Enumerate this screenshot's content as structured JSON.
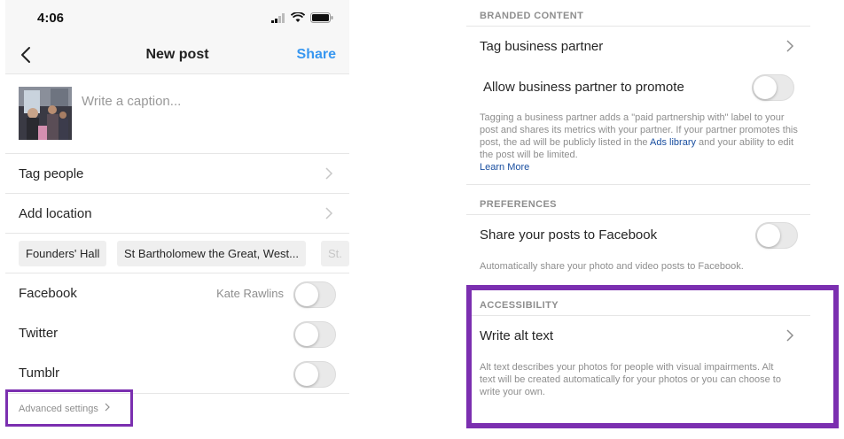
{
  "status": {
    "time": "4:06"
  },
  "nav": {
    "title": "New post",
    "share_label": "Share"
  },
  "caption": {
    "placeholder": "Write a caption..."
  },
  "rows": {
    "tag_people": "Tag people",
    "add_location": "Add location"
  },
  "location_chips": [
    "Founders' Hall",
    "St Bartholomew the Great, West...",
    "St."
  ],
  "share_to": [
    {
      "label": "Facebook",
      "account": "Kate Rawlins",
      "on": false
    },
    {
      "label": "Twitter",
      "account": "",
      "on": false
    },
    {
      "label": "Tumblr",
      "account": "",
      "on": false
    }
  ],
  "advanced": {
    "label": "Advanced settings"
  },
  "right": {
    "branded": {
      "header": "BRANDED CONTENT",
      "tag_partner": "Tag business partner",
      "allow_promote": "Allow business partner to promote",
      "allow_promote_on": false,
      "desc_1": "Tagging a business partner adds a \"paid partnership with\" label to your post and shares its metrics with your partner. If your partner promotes this post, the ad will be publicly listed in the ",
      "ads_library": "Ads library",
      "desc_2": " and your ability to edit the post will be limited.",
      "learn_more": "Learn More"
    },
    "preferences": {
      "header": "PREFERENCES",
      "share_fb": "Share your posts to Facebook",
      "share_fb_on": false,
      "desc": "Automatically share your photo and video posts to Facebook."
    },
    "accessibility": {
      "header": "ACCESSIBILITY",
      "alt_text": "Write alt text",
      "desc": "Alt text describes your photos for people with visual impairments. Alt text will be created automatically for your photos or you can choose to write your own."
    }
  },
  "colors": {
    "accent": "#3897f0",
    "highlight": "#7b2fb0",
    "link": "#1a4fa0"
  }
}
